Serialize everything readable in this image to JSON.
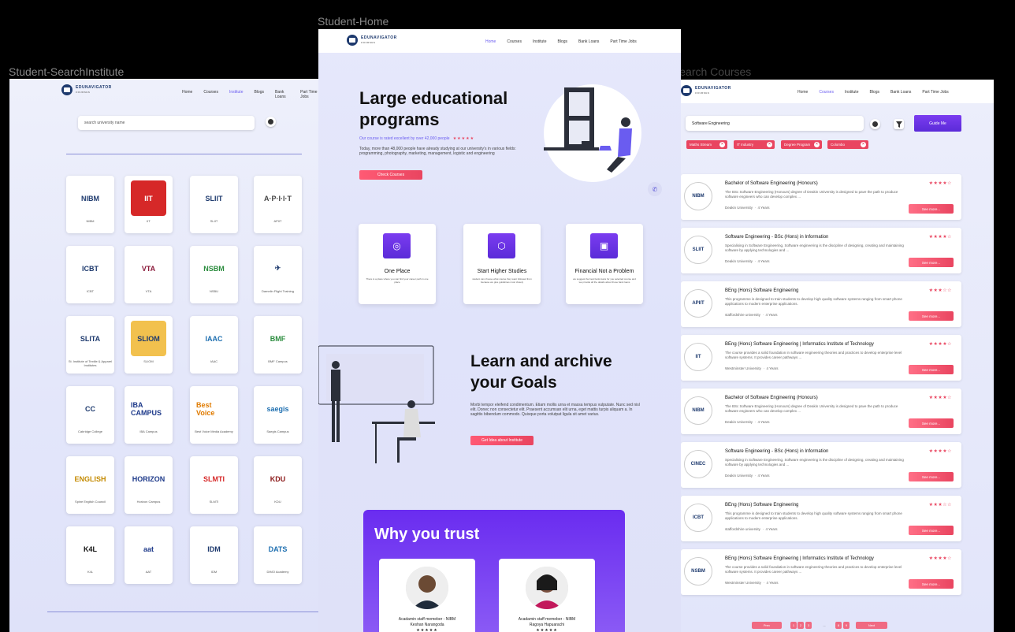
{
  "labels": {
    "search_institute": "Student-SearchInstitute",
    "home": "Student-Home",
    "search_courses": "Student-Search Courses"
  },
  "brand": {
    "name": "EDUNAVIGATOR",
    "sub": "COURSES"
  },
  "nav": [
    "Home",
    "Courses",
    "Institute",
    "Blogs",
    "Bank Loans",
    "Part Time Jobs"
  ],
  "left": {
    "search_placeholder": "search university name",
    "universities": [
      {
        "name": "NIBM",
        "logo": "NIBM",
        "color": "#ffffff",
        "fg": "#1e3a6e"
      },
      {
        "name": "IIT",
        "logo": "IIT",
        "color": "#d62828",
        "fg": "#ffffff"
      },
      {
        "name": "SLIIT",
        "logo": "SLIIT",
        "color": "#ffffff",
        "fg": "#1e3a6e"
      },
      {
        "name": "APIIT",
        "logo": "A·P·I·I·T",
        "color": "#ffffff",
        "fg": "#444444"
      },
      {
        "name": "ICBT",
        "logo": "ICBT",
        "color": "#ffffff",
        "fg": "#1e3a6e"
      },
      {
        "name": "VTA",
        "logo": "VTA",
        "color": "#ffffff",
        "fg": "#8b1a3a"
      },
      {
        "name": "NSBU",
        "logo": "NSBM",
        "color": "#ffffff",
        "fg": "#2b8c3e"
      },
      {
        "name": "Damelin Flight Training",
        "logo": "✈",
        "color": "#ffffff",
        "fg": "#1e3a6e"
      },
      {
        "name": "St. Institute of Textile & Apparel Institutes",
        "logo": "SLITA",
        "color": "#ffffff",
        "fg": "#1e3a6e"
      },
      {
        "name": "SLIOM",
        "logo": "SLIOM",
        "color": "#f2c14e",
        "fg": "#1e3a6e"
      },
      {
        "name": "IAAC",
        "logo": "IAAC",
        "color": "#ffffff",
        "fg": "#1e6fb0"
      },
      {
        "name": "BMF Campus",
        "logo": "BMF",
        "color": "#ffffff",
        "fg": "#2b8c3e"
      },
      {
        "name": "Cabridge College",
        "logo": "CC",
        "color": "#ffffff",
        "fg": "#1e3a6e"
      },
      {
        "name": "IBA Campus",
        "logo": "IBA CAMPUS",
        "color": "#ffffff",
        "fg": "#1e3a8a"
      },
      {
        "name": "Best Voice Media Academy",
        "logo": "Best Voice",
        "color": "#ffffff",
        "fg": "#e07b00"
      },
      {
        "name": "Saegis Campus",
        "logo": "saegis",
        "color": "#ffffff",
        "fg": "#1e6fb0"
      },
      {
        "name": "Spine English Council",
        "logo": "ENGLISH",
        "color": "#ffffff",
        "fg": "#c48a00"
      },
      {
        "name": "Horizon Campus",
        "logo": "HORIZON",
        "color": "#ffffff",
        "fg": "#1e3a8a"
      },
      {
        "name": "SLMTI",
        "logo": "SLMTI",
        "color": "#ffffff",
        "fg": "#d62828"
      },
      {
        "name": "KDU",
        "logo": "KDU",
        "color": "#ffffff",
        "fg": "#8b1a1a"
      },
      {
        "name": "K4L",
        "logo": "K4L",
        "color": "#ffffff",
        "fg": "#111111"
      },
      {
        "name": "AAT",
        "logo": "aat",
        "color": "#ffffff",
        "fg": "#1e3a8a"
      },
      {
        "name": "IDM",
        "logo": "IDM",
        "color": "#ffffff",
        "fg": "#1e3a6e"
      },
      {
        "name": "DIMO Academy",
        "logo": "DATS",
        "color": "#ffffff",
        "fg": "#1e6fb0"
      }
    ]
  },
  "home": {
    "hero_title_1": "Large educational",
    "hero_title_2": "programs",
    "rated": "Our course is rated excellent by over 42,000 people",
    "stars": "★★★★★",
    "desc": "Today, more than 48,000 people have already studying  at our university's in various fields: programming, photography, marketing, management, logistic and engineering",
    "cta": "Check Courses",
    "features": [
      {
        "title": "One Place",
        "icon": "globe-icon",
        "glyph": "◎",
        "desc": "There is a place where you can find your career path in one place"
      },
      {
        "title": "Start Higher Studies",
        "icon": "graduation-cap-icon",
        "glyph": "⬡",
        "desc": "student can choose what course they want followed from because we give guidelines most closely"
      },
      {
        "title": "Financial Not a Problem",
        "icon": "wallet-icon",
        "glyph": "▣",
        "desc": "we suggest the best bank loans for you selected course and we provide all the details about those bank loans"
      }
    ],
    "learn_title_1": "Learn and archive",
    "learn_title_2": "your Goals",
    "learn_desc": "Morbi tempor eleifend condimentum. Etiam mollis urna et massa tempus vulputate. Nunc sed nisl elit. Donec non consectetur elit. Praesent accumsan elit urna, eget mattis turpis aliquam a. In sagittis bibendum commodo. Quisque porta volutpat ligula sit amet varius.",
    "learn_cta": "Get Idea about Institute",
    "trust_title": "Why you trust",
    "testimonials": [
      {
        "role": "Acadamin staff memeber - NIBM",
        "name": "Keshan Narangoda"
      },
      {
        "role": "Acadamin staff memeber - NIBM",
        "name": "Ragoya Hapuarachi"
      }
    ]
  },
  "right": {
    "search_value": "Software Engineering",
    "guide_btn": "Guide Me",
    "chips": [
      "Maths Stream",
      "IT Industry",
      "Degree Program",
      "Colombo"
    ],
    "courses": [
      {
        "title": "Bachelor of Software Engineering (Honours)",
        "desc": "The BSc Software Engineering (Honours) degree of Deakin University is designed to pave the path to produce software engineers who can develop complex ...",
        "uni": "Deakin University",
        "duration": "4 Years",
        "stars": "★★★★☆",
        "logo": "NIBM"
      },
      {
        "title": "Software Engineering - BSc (Hons) in Information",
        "desc": "Specialising in Software Engineering, Software engineering is the discipline of designing, creating and maintaining software by applying technologies and ...",
        "uni": "Deakin University",
        "duration": "4 Years",
        "stars": "★★★★☆",
        "logo": "SLIIT"
      },
      {
        "title": "BEng (Hons) Software Engineering",
        "desc": "This programme is designed to train students to develop high quality software systems ranging from smart phone applications to modern enterprise applications.",
        "uni": "staffordshire university",
        "duration": "4 Years",
        "stars": "★★★☆☆",
        "logo": "APIIT"
      },
      {
        "title": "BEng (Hons) Software Engineering | Informatics Institute of Technology",
        "desc": "The course provides a solid foundation in software engineering theories and practices to develop enterprise level software systems. It provides career pathways ...",
        "uni": "Westminster University",
        "duration": "4 Years",
        "stars": "★★★★☆",
        "logo": "IIT"
      },
      {
        "title": "Bachelor of Software Engineering (Honours)",
        "desc": "The BSc Software Engineering (Honours) degree of Deakin University is designed to pave the path to produce software engineers who can develop complex ...",
        "uni": "Deakin University",
        "duration": "4 Years",
        "stars": "★★★★☆",
        "logo": "NIBM"
      },
      {
        "title": "Software Engineering - BSc (Hons) in Information",
        "desc": "Specialising in Software Engineering, Software engineering is the discipline of designing, creating and maintaining software by applying technologies and ...",
        "uni": "Deakin University",
        "duration": "4 Years",
        "stars": "★★★★☆",
        "logo": "CINEC"
      },
      {
        "title": "BEng (Hons) Software Engineering",
        "desc": "This programme is designed to train students to develop high quality software systems ranging from smart phone applications to modern enterprise applications.",
        "uni": "staffordshire university",
        "duration": "4 Years",
        "stars": "★★★☆☆",
        "logo": "ICBT"
      },
      {
        "title": "BEng (Hons) Software Engineering | Informatics Institute of Technology",
        "desc": "The course provides a solid foundation in software engineering theories and practices to develop enterprise level software systems. It provides career pathways ...",
        "uni": "Westminster University",
        "duration": "4 Years",
        "stars": "★★★★☆",
        "logo": "NSBM"
      }
    ],
    "see_more": "See more...",
    "pager": {
      "prev": "Prev",
      "next": "Next",
      "pages": [
        "1",
        "2",
        "3",
        "...",
        "8",
        "9"
      ]
    }
  }
}
